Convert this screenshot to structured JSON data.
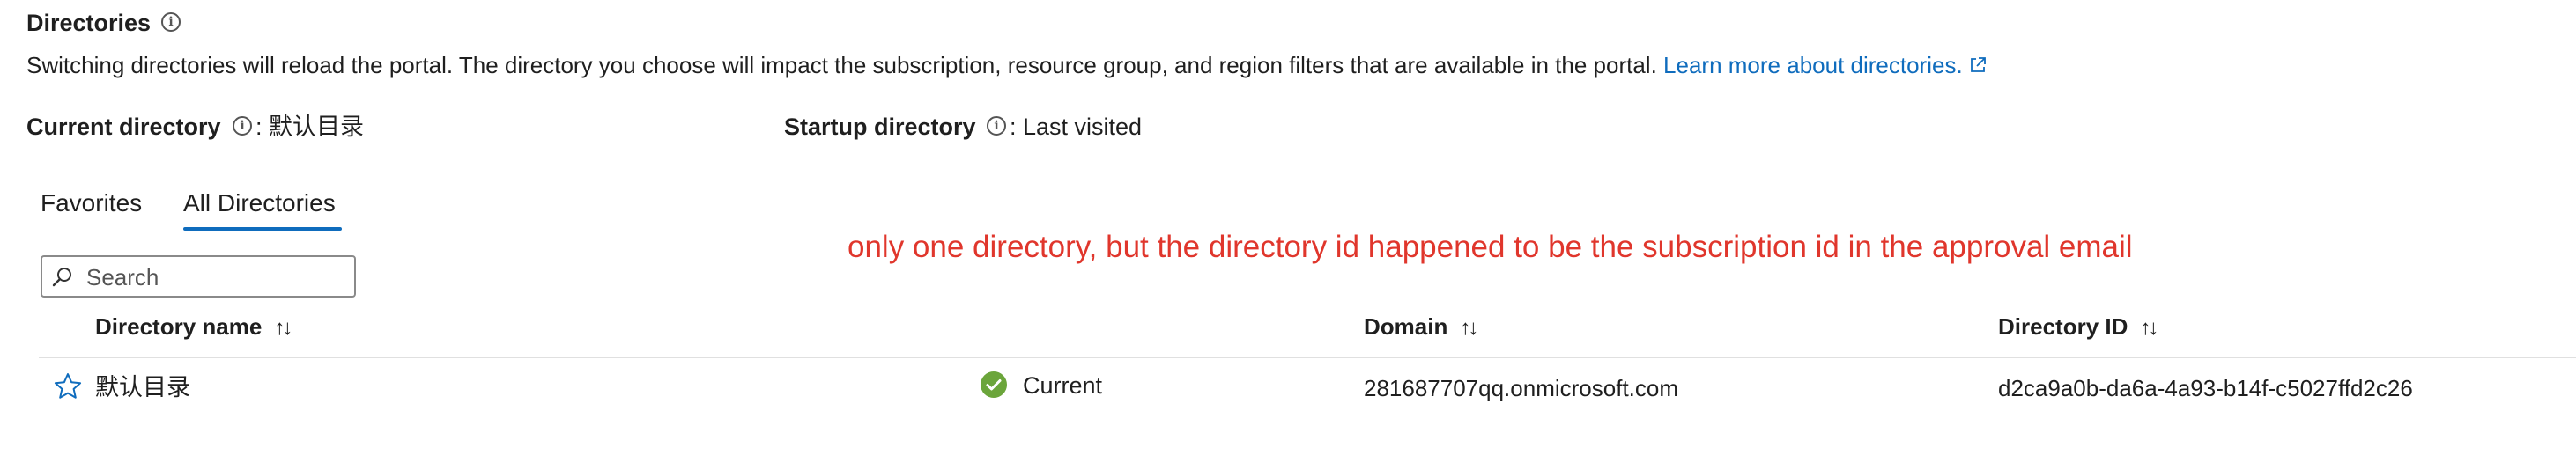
{
  "header": {
    "title": "Directories",
    "description": "Switching directories will reload the portal. The directory you choose will impact the subscription, resource group, and region filters that are available in the portal.",
    "learn_more_link": "Learn more about directories."
  },
  "current_directory": {
    "label": "Current directory",
    "value": ": 默认目录"
  },
  "startup_directory": {
    "label": "Startup directory",
    "value": ": Last visited"
  },
  "tabs": [
    {
      "label": "Favorites",
      "selected": false
    },
    {
      "label": "All Directories",
      "selected": true
    }
  ],
  "annotation": "only one directory, but the directory id happened to be the subscription id in the approval email",
  "search": {
    "placeholder": "Search",
    "value": ""
  },
  "table": {
    "columns": [
      "Directory name",
      "Domain",
      "Directory ID"
    ],
    "rows": [
      {
        "name": "默认目录",
        "status": "Current",
        "domain": "281687707qq.onmicrosoft.com",
        "directory_id": "d2ca9a0b-da6a-4a93-b14f-c5027ffd2c26"
      }
    ]
  },
  "colors": {
    "accent": "#0f6cbd",
    "annotation": "#e0362c",
    "success": "#6ba53b"
  },
  "icons": [
    "info-icon",
    "external-link-icon",
    "search-icon",
    "sort-icon",
    "star-icon",
    "check-circle-icon"
  ]
}
